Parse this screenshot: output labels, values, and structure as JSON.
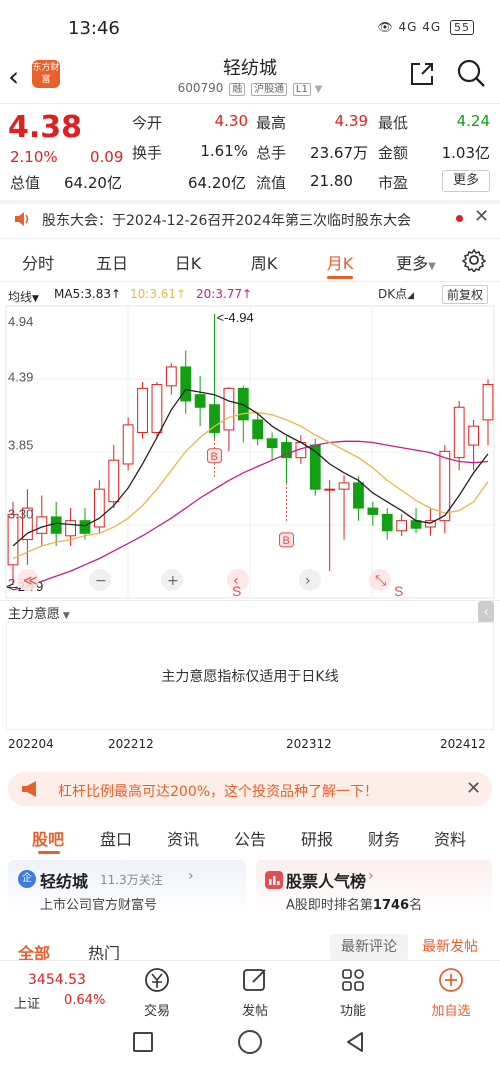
{
  "status_bar": {
    "time": "13:46",
    "icons": "👁 4G 4G",
    "battery": "55"
  },
  "header": {
    "logo_text": "东方财富",
    "title": "轻纺城",
    "code": "600790",
    "tags": [
      "融",
      "沪股通",
      "L1"
    ]
  },
  "quote": {
    "price": "4.38",
    "change_pct": "2.10%",
    "change_val": "0.09",
    "fields": [
      {
        "label": "今开",
        "value": "4.30",
        "color": "red"
      },
      {
        "label": "最高",
        "value": "4.39",
        "color": "red"
      },
      {
        "label": "最低",
        "value": "4.24",
        "color": "green"
      },
      {
        "label": "换手",
        "value": "1.61%",
        "color": "normal"
      },
      {
        "label": "总手",
        "value": "23.67万",
        "color": "normal"
      },
      {
        "label": "金额",
        "value": "1.03亿",
        "color": "normal"
      },
      {
        "label": "总值",
        "value": "64.20亿",
        "color": "normal"
      },
      {
        "label": "流值",
        "value": "64.20亿",
        "color": "normal"
      },
      {
        "label": "市盈",
        "value": "21.80",
        "color": "normal"
      }
    ],
    "more_label": "更多"
  },
  "notice": {
    "text": "股东大会：于2024-12-26召开2024年第三次临时股东大会"
  },
  "period_tabs": [
    "分时",
    "五日",
    "日K",
    "周K",
    "月K",
    "更多"
  ],
  "indicator_bar": {
    "main": "均线",
    "ma5": "MA5:3.83↑",
    "ma10": "10:3.61↑",
    "ma20": "20:3.77↑",
    "dk": "DK点",
    "adjust": "前复权"
  },
  "chart_data": {
    "type": "candlestick",
    "y_ticks": [
      "4.94",
      "4.39",
      "3.85",
      "3.30",
      "2.75"
    ],
    "ylim": [
      2.75,
      4.94
    ],
    "max_label": "<-4.94",
    "min_label": "<-2.79",
    "signals": [
      "B",
      "B",
      "S",
      "S"
    ],
    "x_labels": [
      "202204",
      "202212",
      "202312",
      "202412"
    ],
    "candles": [
      {
        "o": 2.95,
        "c": 3.35,
        "h": 3.45,
        "l": 2.79
      },
      {
        "o": 3.15,
        "c": 3.4,
        "h": 3.55,
        "l": 2.95
      },
      {
        "o": 3.2,
        "c": 3.33,
        "h": 3.5,
        "l": 3.1
      },
      {
        "o": 3.33,
        "c": 3.2,
        "h": 3.45,
        "l": 3.1
      },
      {
        "o": 3.18,
        "c": 3.3,
        "h": 3.4,
        "l": 3.1
      },
      {
        "o": 3.3,
        "c": 3.2,
        "h": 3.4,
        "l": 3.15
      },
      {
        "o": 3.25,
        "c": 3.55,
        "h": 3.62,
        "l": 3.2
      },
      {
        "o": 3.45,
        "c": 3.78,
        "h": 3.9,
        "l": 3.4
      },
      {
        "o": 3.75,
        "c": 4.06,
        "h": 4.12,
        "l": 3.7
      },
      {
        "o": 4.0,
        "c": 4.35,
        "h": 4.4,
        "l": 3.95
      },
      {
        "o": 4.0,
        "c": 4.38,
        "h": 4.4,
        "l": 3.95
      },
      {
        "o": 4.37,
        "c": 4.52,
        "h": 4.55,
        "l": 4.3
      },
      {
        "o": 4.52,
        "c": 4.25,
        "h": 4.65,
        "l": 4.15
      },
      {
        "o": 4.3,
        "c": 4.2,
        "h": 4.45,
        "l": 4.05
      },
      {
        "o": 4.22,
        "c": 4.0,
        "h": 4.94,
        "l": 3.95
      },
      {
        "o": 4.02,
        "c": 4.35,
        "h": 4.36,
        "l": 3.85
      },
      {
        "o": 4.35,
        "c": 4.1,
        "h": 4.37,
        "l": 3.92
      },
      {
        "o": 4.1,
        "c": 3.95,
        "h": 4.15,
        "l": 3.9
      },
      {
        "o": 3.95,
        "c": 3.88,
        "h": 4.0,
        "l": 3.78
      },
      {
        "o": 3.92,
        "c": 3.8,
        "h": 3.97,
        "l": 3.6
      },
      {
        "o": 3.8,
        "c": 3.92,
        "h": 3.98,
        "l": 3.75
      },
      {
        "o": 3.9,
        "c": 3.55,
        "h": 3.95,
        "l": 3.5
      },
      {
        "o": 3.55,
        "c": 3.55,
        "h": 3.62,
        "l": 2.9
      },
      {
        "o": 3.55,
        "c": 3.6,
        "h": 3.66,
        "l": 3.15
      },
      {
        "o": 3.6,
        "c": 3.4,
        "h": 3.65,
        "l": 3.3
      },
      {
        "o": 3.4,
        "c": 3.35,
        "h": 3.45,
        "l": 3.26
      },
      {
        "o": 3.35,
        "c": 3.22,
        "h": 3.4,
        "l": 3.15
      },
      {
        "o": 3.22,
        "c": 3.3,
        "h": 3.35,
        "l": 3.18
      },
      {
        "o": 3.3,
        "c": 3.24,
        "h": 3.4,
        "l": 3.2
      },
      {
        "o": 3.25,
        "c": 3.3,
        "h": 3.4,
        "l": 3.18
      },
      {
        "o": 3.3,
        "c": 3.85,
        "h": 3.9,
        "l": 3.2
      },
      {
        "o": 3.8,
        "c": 4.2,
        "h": 4.25,
        "l": 3.7
      },
      {
        "o": 3.9,
        "c": 4.05,
        "h": 4.1,
        "l": 3.7
      },
      {
        "o": 4.1,
        "c": 4.38,
        "h": 4.42,
        "l": 3.9
      }
    ],
    "ma5": [
      3.1,
      3.2,
      3.25,
      3.28,
      3.27,
      3.26,
      3.32,
      3.42,
      3.56,
      3.75,
      3.96,
      4.18,
      4.34,
      4.32,
      4.3,
      4.25,
      4.22,
      4.15,
      4.05,
      3.98,
      3.92,
      3.85,
      3.75,
      3.68,
      3.62,
      3.52,
      3.45,
      3.38,
      3.3,
      3.28,
      3.34,
      3.5,
      3.68,
      3.83
    ],
    "ma10": [
      3.0,
      3.05,
      3.1,
      3.13,
      3.15,
      3.18,
      3.2,
      3.25,
      3.32,
      3.42,
      3.55,
      3.7,
      3.85,
      3.96,
      4.05,
      4.12,
      4.15,
      4.16,
      4.14,
      4.1,
      4.05,
      3.98,
      3.92,
      3.86,
      3.8,
      3.72,
      3.62,
      3.54,
      3.46,
      3.4,
      3.36,
      3.38,
      3.45,
      3.61
    ],
    "ma20": [
      2.75,
      2.78,
      2.82,
      2.86,
      2.9,
      2.95,
      3.0,
      3.06,
      3.12,
      3.18,
      3.25,
      3.32,
      3.4,
      3.48,
      3.55,
      3.62,
      3.68,
      3.73,
      3.78,
      3.83,
      3.87,
      3.9,
      3.92,
      3.93,
      3.93,
      3.92,
      3.9,
      3.88,
      3.86,
      3.84,
      3.8,
      3.77,
      3.76,
      3.77
    ]
  },
  "chart_controls": [
    "≪",
    "−",
    "+",
    "‹",
    "›",
    "⤡"
  ],
  "sub_indicator": {
    "name": "主力意愿",
    "note": "主力意愿指标仅适用于日K线"
  },
  "promo": {
    "text": "杠杆比例最高可达200%，这个投资品种了解一下！"
  },
  "main_tabs": [
    "股吧",
    "盘口",
    "资讯",
    "公告",
    "研报",
    "财务",
    "资料"
  ],
  "cards": {
    "left": {
      "badge": "企",
      "name": "轻纺城",
      "followers": "11.3万关注",
      "desc": "上市公司官方财富号"
    },
    "right": {
      "name": "股票人气榜",
      "desc_prefix": "A股即时排名第",
      "rank": "1746",
      "desc_suffix": "名"
    }
  },
  "feed_tabs": {
    "all": "全部",
    "hot": "热门",
    "latest_comment": "最新评论",
    "latest_post": "最新发帖"
  },
  "bottom_bar": {
    "index_value": "3454.53",
    "index_name": "上证",
    "index_change": "0.64%",
    "items": [
      "交易",
      "发帖",
      "功能",
      "加自选"
    ]
  },
  "colors": {
    "up": "#e02020",
    "down": "#12a012",
    "accent": "#e8612c",
    "ma5": "#222222",
    "ma10": "#e8b84a",
    "ma20": "#c0208c"
  }
}
